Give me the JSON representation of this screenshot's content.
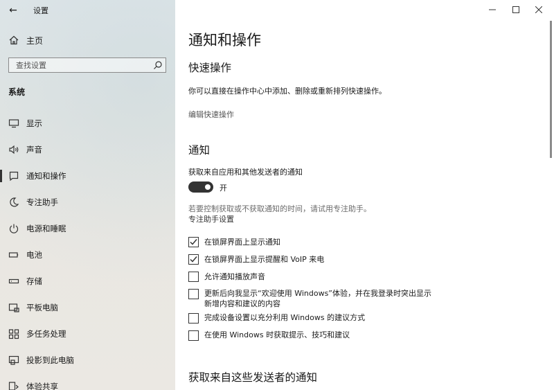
{
  "window": {
    "app_title": "设置",
    "back_glyph": "←"
  },
  "sidebar": {
    "home_label": "主页",
    "search_placeholder": "查找设置",
    "section_title": "系统",
    "items": [
      {
        "label": "显示",
        "icon": "display-icon"
      },
      {
        "label": "声音",
        "icon": "speaker-icon"
      },
      {
        "label": "通知和操作",
        "icon": "notification-icon",
        "selected": true
      },
      {
        "label": "专注助手",
        "icon": "moon-icon"
      },
      {
        "label": "电源和睡眠",
        "icon": "power-icon"
      },
      {
        "label": "电池",
        "icon": "battery-icon"
      },
      {
        "label": "存储",
        "icon": "storage-icon"
      },
      {
        "label": "平板电脑",
        "icon": "tablet-icon"
      },
      {
        "label": "多任务处理",
        "icon": "multitask-icon"
      },
      {
        "label": "投影到此电脑",
        "icon": "project-icon"
      },
      {
        "label": "体验共享",
        "icon": "share-icon"
      }
    ]
  },
  "main": {
    "page_title": "通知和操作",
    "quick_actions": {
      "heading": "快速操作",
      "description": "你可以直接在操作中心中添加、删除或重新排列快速操作。",
      "edit_link": "编辑快速操作"
    },
    "notifications": {
      "heading": "通知",
      "get_notifications_label": "获取来自应用和其他发送者的通知",
      "toggle_state": "开",
      "toggle_on": true,
      "focus_hint": "若要控制获取或不获取通知的时间，请试用专注助手。",
      "focus_link": "专注助手设置",
      "checkboxes": [
        {
          "label": "在锁屏界面上显示通知",
          "checked": true
        },
        {
          "label": "在锁屏界面上显示提醒和 VoIP 来电",
          "checked": true
        },
        {
          "label": "允许通知播放声音",
          "checked": false
        },
        {
          "label_line1": "更新后向我显示“欢迎使用 Windows”体验，并在我登录时突出显示",
          "label_line2": "新增内容和建议的内容",
          "checked": false
        },
        {
          "label": "完成设备设置以充分利用 Windows 的建议方式",
          "checked": false
        },
        {
          "label": "在使用 Windows 时获取提示、技巧和建议",
          "checked": false
        }
      ]
    },
    "senders_heading": "获取来自这些发送者的通知"
  },
  "colors": {
    "toggle_on": "#333333",
    "text": "#1a1a1a"
  }
}
